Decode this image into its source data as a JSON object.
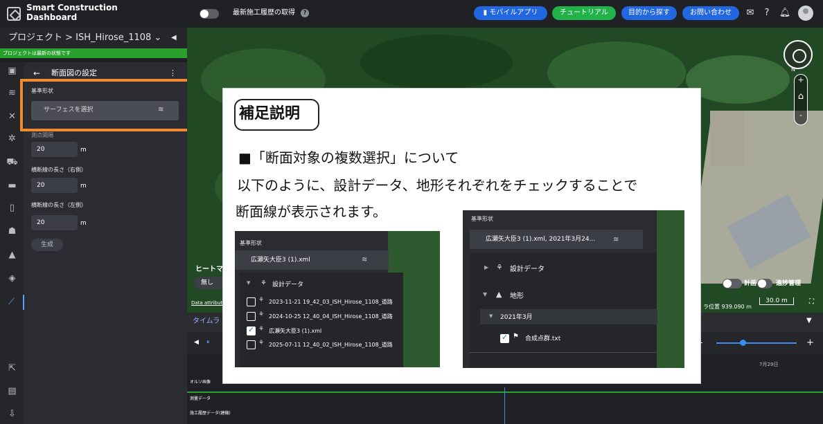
{
  "topbar": {
    "brand_line1": "Smart Construction",
    "brand_line2": "Dashboard",
    "history_label": "最新施工履歴の取得",
    "help": "?",
    "mobile_app": "モバイルアプリ",
    "tutorial": "チュートリアル",
    "find_by_purpose": "目的から探す",
    "contact": "お問い合わせ",
    "icons": [
      "notification-icon",
      "help-icon",
      "bell-icon",
      "avatar"
    ]
  },
  "project": {
    "breadcrumb": "プロジェクト > ISH_Hirose_1108 ⌄",
    "collapse": "◀",
    "status": "プロジェクトは最新の状態です"
  },
  "panel": {
    "back": "←",
    "title": "断面図の設定",
    "menu": "⋮",
    "base_shape_label": "基準形状",
    "surface_placeholder": "サーフェスを選択",
    "interval_label": "測点間隔",
    "interval_value": "20",
    "right_label": "横断線の長さ（右側）",
    "right_value": "20",
    "left_label": "横断線の長さ（左側）",
    "left_value": "20",
    "unit": "m",
    "generate": "生成"
  },
  "map": {
    "heatmap_label": "ヒートマ",
    "heatmap_value": "無し",
    "data_attribution": "Data attributi",
    "compass_n": "N",
    "zoom_in": "+",
    "home": "⌂",
    "zoom_out": "-",
    "plan_label": "計画",
    "progress_label": "進捗管理",
    "mouse_position": "ラ位置 939.090 m",
    "scale": "30.0 m",
    "fullscreen": "⛶"
  },
  "timeline": {
    "title": "タイムラ",
    "chevron": "▼",
    "prev": "◀",
    "pause": "⏸",
    "minus": "-",
    "plus": "+",
    "zoom_level": 0.33,
    "date_label": "7月29日",
    "rows": [
      "オルソ画像",
      "測量データ",
      "施工履歴データ(建機)"
    ]
  },
  "card": {
    "title": "補足説明",
    "line1": "■「断面対象の複数選択」について",
    "line2": "以下のように、設計データ、地形それぞれをチェックすることで",
    "line3": "断面線が表示されます。"
  },
  "inset1": {
    "label": "基準形状",
    "select_value": "広瀬矢大臣3 (1).xml",
    "group_label": "設計データ",
    "items": [
      {
        "label": "2023-11-21 19_42_03_ISH_Hirose_1108_道路",
        "checked": false
      },
      {
        "label": "2024-10-25 12_40_04_ISH_Hirose_1108_道路",
        "checked": false
      },
      {
        "label": "広瀬矢大臣3 (1).xml",
        "checked": true
      },
      {
        "label": "2025-07-11 12_40_02_ISH_Hirose_1108_道路",
        "checked": false
      }
    ]
  },
  "inset2": {
    "label": "基準形状",
    "select_value": "広瀬矢大臣3 (1).xml, 2021年3月24...",
    "design_label": "設計データ",
    "terrain_label": "地形",
    "date_label": "2021年3月",
    "file_label": "合成点群.txt",
    "file_checked": true
  }
}
